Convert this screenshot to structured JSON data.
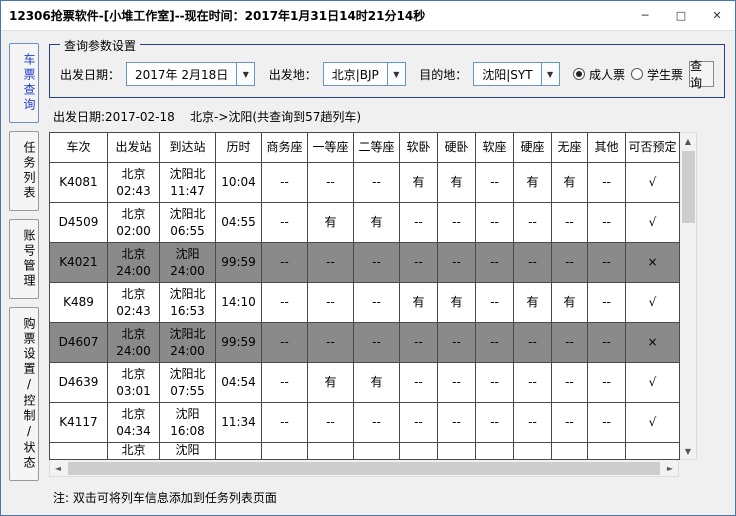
{
  "window": {
    "title": "12306抢票软件-[小堆工作室]--现在时间：2017年1月31日14时21分14秒",
    "controls": {
      "minimize": "─",
      "maximize": "□",
      "close": "✕"
    }
  },
  "icons": {
    "dropdown_arrow": "▼",
    "scroll_up": "▲",
    "scroll_down": "▼",
    "scroll_left": "◄",
    "scroll_right": "►"
  },
  "sidebar": {
    "tabs": [
      {
        "label": "车票查询",
        "active": true
      },
      {
        "label": "任务列表",
        "active": false
      },
      {
        "label": "账号管理",
        "active": false
      },
      {
        "label": "购票设置/控制/状态",
        "active": false
      }
    ]
  },
  "query_panel": {
    "title": "查询参数设置",
    "depart_date_label": "出发日期：",
    "depart_date_value": "2017年 2月18日",
    "from_label": "出发地：",
    "from_value": "北京|BJP",
    "to_label": "目的地：",
    "to_value": "沈阳|SYT",
    "ticket_types": [
      {
        "label": "成人票",
        "selected": true
      },
      {
        "label": "学生票",
        "selected": false
      }
    ],
    "query_button_label": "查询"
  },
  "result_summary": "出发日期:2017-02-18    北京->沈阳(共查询到57趟列车)",
  "table": {
    "headers": [
      "车次",
      "出发站",
      "到达站",
      "历时",
      "商务座",
      "一等座",
      "二等座",
      "软卧",
      "硬卧",
      "软座",
      "硬座",
      "无座",
      "其他",
      "可否预定"
    ],
    "rows": [
      {
        "train": "K4081",
        "from_station": "北京",
        "from_time": "02:43",
        "to_station": "沈阳北",
        "to_time": "11:47",
        "duration": "10:04",
        "seats": [
          "--",
          "--",
          "--",
          "有",
          "有",
          "--",
          "有",
          "有",
          "--"
        ],
        "bookable": "√",
        "highlighted": false,
        "partial": false
      },
      {
        "train": "D4509",
        "from_station": "北京",
        "from_time": "02:00",
        "to_station": "沈阳北",
        "to_time": "06:55",
        "duration": "04:55",
        "seats": [
          "--",
          "有",
          "有",
          "--",
          "--",
          "--",
          "--",
          "--",
          "--"
        ],
        "bookable": "√",
        "highlighted": false,
        "partial": false
      },
      {
        "train": "K4021",
        "from_station": "北京",
        "from_time": "24:00",
        "to_station": "沈阳",
        "to_time": "24:00",
        "duration": "99:59",
        "seats": [
          "--",
          "--",
          "--",
          "--",
          "--",
          "--",
          "--",
          "--",
          "--"
        ],
        "bookable": "×",
        "highlighted": true,
        "partial": false
      },
      {
        "train": "K489",
        "from_station": "北京",
        "from_time": "02:43",
        "to_station": "沈阳北",
        "to_time": "16:53",
        "duration": "14:10",
        "seats": [
          "--",
          "--",
          "--",
          "有",
          "有",
          "--",
          "有",
          "有",
          "--"
        ],
        "bookable": "√",
        "highlighted": false,
        "partial": false
      },
      {
        "train": "D4607",
        "from_station": "北京",
        "from_time": "24:00",
        "to_station": "沈阳北",
        "to_time": "24:00",
        "duration": "99:59",
        "seats": [
          "--",
          "--",
          "--",
          "--",
          "--",
          "--",
          "--",
          "--",
          "--"
        ],
        "bookable": "×",
        "highlighted": true,
        "partial": false
      },
      {
        "train": "D4639",
        "from_station": "北京",
        "from_time": "03:01",
        "to_station": "沈阳北",
        "to_time": "07:55",
        "duration": "04:54",
        "seats": [
          "--",
          "有",
          "有",
          "--",
          "--",
          "--",
          "--",
          "--",
          "--"
        ],
        "bookable": "√",
        "highlighted": false,
        "partial": false
      },
      {
        "train": "K4117",
        "from_station": "北京",
        "from_time": "04:34",
        "to_station": "沈阳",
        "to_time": "16:08",
        "duration": "11:34",
        "seats": [
          "--",
          "--",
          "--",
          "--",
          "--",
          "--",
          "--",
          "--",
          "--"
        ],
        "bookable": "√",
        "highlighted": false,
        "partial": false
      },
      {
        "train": "",
        "from_station": "北京",
        "from_time": "",
        "to_station": "沈阳",
        "to_time": "",
        "duration": "",
        "seats": [
          "",
          "",
          "",
          "",
          "",
          "",
          "",
          "",
          ""
        ],
        "bookable": "",
        "highlighted": false,
        "partial": true
      }
    ]
  },
  "note": "注: 双击可将列车信息添加到任务列表页面"
}
